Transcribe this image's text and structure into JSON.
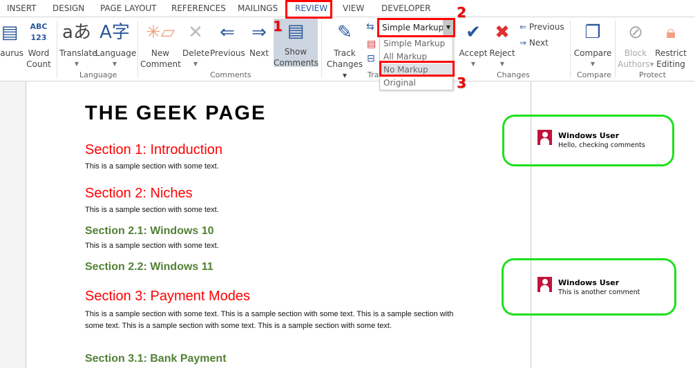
{
  "tabs": [
    "INSERT",
    "DESIGN",
    "PAGE LAYOUT",
    "REFERENCES",
    "MAILINGS",
    "REVIEW",
    "VIEW",
    "DEVELOPER"
  ],
  "active_tab": "REVIEW",
  "ribbon": {
    "proofing": {
      "thesaurus": "saurus",
      "word_count_1": "Word",
      "word_count_2": "Count"
    },
    "language": {
      "translate": "Translate",
      "language": "Language",
      "label": "Language"
    },
    "comments": {
      "new_1": "New",
      "new_2": "Comment",
      "delete": "Delete",
      "previous": "Previous",
      "next": "Next",
      "show_1": "Show",
      "show_2": "Comments",
      "label": "Comments"
    },
    "tracking": {
      "track_1": "Track",
      "track_2": "Changes",
      "label": "Tra",
      "markup_selected": "Simple Markup",
      "markup_options": [
        "Simple Markup",
        "All Markup",
        "No Markup",
        "Original"
      ],
      "highlighted_option": "No Markup"
    },
    "changes": {
      "accept": "Accept",
      "reject": "Reject",
      "previous": "Previous",
      "next": "Next",
      "label": "Changes"
    },
    "compare": {
      "compare": "Compare",
      "label": "Compare"
    },
    "protect": {
      "block_1": "Block",
      "block_2": "Authors",
      "restrict_1": "Restrict",
      "restrict_2": "Editing",
      "label": "Protect"
    }
  },
  "annotations": [
    "1",
    "2",
    "3"
  ],
  "document": {
    "title": "THE GEEK PAGE",
    "sections": [
      {
        "heading": "Section 1: Introduction",
        "level": 1,
        "body": "This is a sample section with some text."
      },
      {
        "heading": "Section 2: Niches",
        "level": 1,
        "body": "This is a sample section with some text."
      },
      {
        "heading": "Section 2.1: Windows 10",
        "level": 2,
        "body": "This is a sample section with some text."
      },
      {
        "heading": "Section 2.2: Windows 11",
        "level": 2,
        "body": ""
      },
      {
        "heading": "Section 3: Payment Modes",
        "level": 1,
        "body": "This is a sample section with some text. This is a sample section with some text. This is a sample section with some text. This is a sample section with some text. This is a sample section with some text."
      },
      {
        "heading": "Section 3.1: Bank Payment",
        "level": 2,
        "body": ""
      }
    ]
  },
  "comments": [
    {
      "author": "Windows User",
      "text": "Hello, checking comments"
    },
    {
      "author": "Windows User",
      "text": "This is another comment"
    }
  ],
  "colors": {
    "annotation_red": "#ff0000",
    "comment_highlight": "#1de01d",
    "avatar": "#c0143c",
    "heading1": "#ff0000",
    "heading2": "#538135",
    "tab_active": "#2b579a"
  }
}
